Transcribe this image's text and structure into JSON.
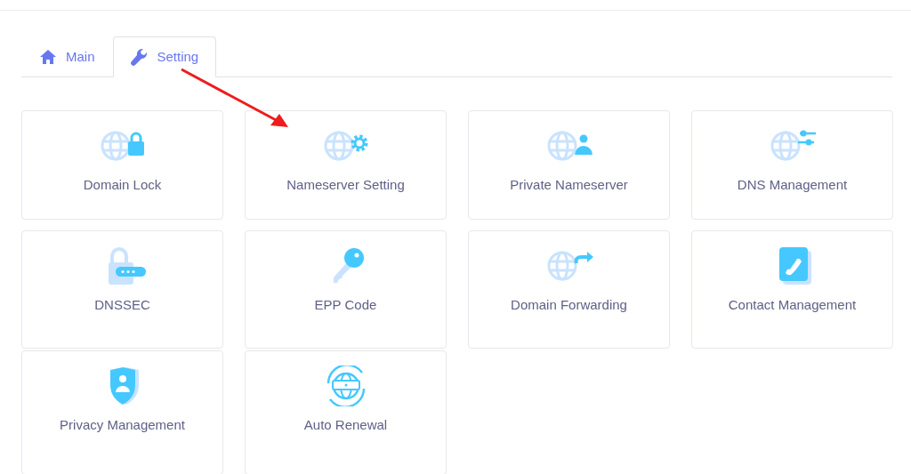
{
  "tabs": [
    {
      "label": "Main",
      "kind": "home",
      "selected": false
    },
    {
      "label": "Setting",
      "kind": "wrench",
      "selected": true
    }
  ],
  "cards": [
    {
      "label": "Domain Lock",
      "kind": "globelock"
    },
    {
      "label": "Nameserver Setting",
      "kind": "globegear"
    },
    {
      "label": "Private Nameserver",
      "kind": "globeuser"
    },
    {
      "label": "DNS Management",
      "kind": "globesliders"
    },
    {
      "label": "DNSSEC",
      "kind": "padlock"
    },
    {
      "label": "EPP Code",
      "kind": "key"
    },
    {
      "label": "Domain Forwarding",
      "kind": "globeforward"
    },
    {
      "label": "Contact Management",
      "kind": "phone"
    },
    {
      "label": "Privacy Management",
      "kind": "shield"
    },
    {
      "label": "Auto Renewal",
      "kind": "globecom"
    }
  ]
}
